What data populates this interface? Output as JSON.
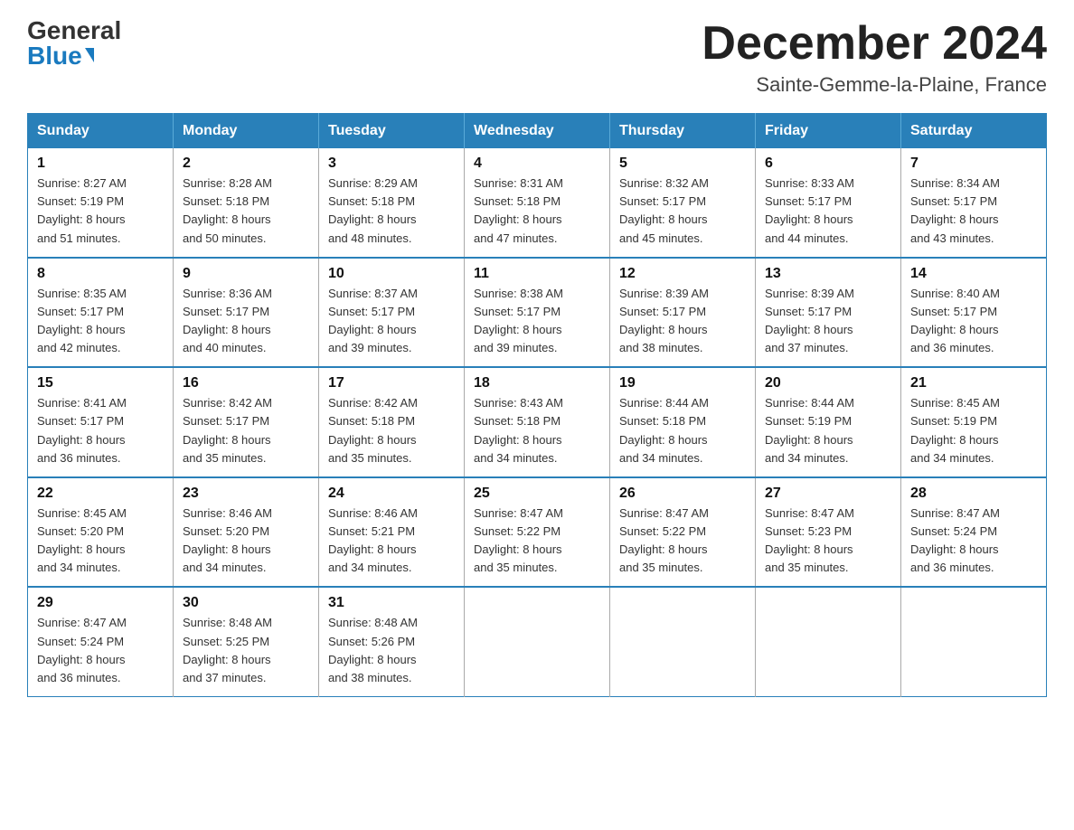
{
  "logo": {
    "general": "General",
    "blue": "Blue"
  },
  "title": "December 2024",
  "location": "Sainte-Gemme-la-Plaine, France",
  "days_of_week": [
    "Sunday",
    "Monday",
    "Tuesday",
    "Wednesday",
    "Thursday",
    "Friday",
    "Saturday"
  ],
  "weeks": [
    [
      {
        "day": "1",
        "sunrise": "8:27 AM",
        "sunset": "5:19 PM",
        "daylight": "8 hours and 51 minutes."
      },
      {
        "day": "2",
        "sunrise": "8:28 AM",
        "sunset": "5:18 PM",
        "daylight": "8 hours and 50 minutes."
      },
      {
        "day": "3",
        "sunrise": "8:29 AM",
        "sunset": "5:18 PM",
        "daylight": "8 hours and 48 minutes."
      },
      {
        "day": "4",
        "sunrise": "8:31 AM",
        "sunset": "5:18 PM",
        "daylight": "8 hours and 47 minutes."
      },
      {
        "day": "5",
        "sunrise": "8:32 AM",
        "sunset": "5:17 PM",
        "daylight": "8 hours and 45 minutes."
      },
      {
        "day": "6",
        "sunrise": "8:33 AM",
        "sunset": "5:17 PM",
        "daylight": "8 hours and 44 minutes."
      },
      {
        "day": "7",
        "sunrise": "8:34 AM",
        "sunset": "5:17 PM",
        "daylight": "8 hours and 43 minutes."
      }
    ],
    [
      {
        "day": "8",
        "sunrise": "8:35 AM",
        "sunset": "5:17 PM",
        "daylight": "8 hours and 42 minutes."
      },
      {
        "day": "9",
        "sunrise": "8:36 AM",
        "sunset": "5:17 PM",
        "daylight": "8 hours and 40 minutes."
      },
      {
        "day": "10",
        "sunrise": "8:37 AM",
        "sunset": "5:17 PM",
        "daylight": "8 hours and 39 minutes."
      },
      {
        "day": "11",
        "sunrise": "8:38 AM",
        "sunset": "5:17 PM",
        "daylight": "8 hours and 39 minutes."
      },
      {
        "day": "12",
        "sunrise": "8:39 AM",
        "sunset": "5:17 PM",
        "daylight": "8 hours and 38 minutes."
      },
      {
        "day": "13",
        "sunrise": "8:39 AM",
        "sunset": "5:17 PM",
        "daylight": "8 hours and 37 minutes."
      },
      {
        "day": "14",
        "sunrise": "8:40 AM",
        "sunset": "5:17 PM",
        "daylight": "8 hours and 36 minutes."
      }
    ],
    [
      {
        "day": "15",
        "sunrise": "8:41 AM",
        "sunset": "5:17 PM",
        "daylight": "8 hours and 36 minutes."
      },
      {
        "day": "16",
        "sunrise": "8:42 AM",
        "sunset": "5:17 PM",
        "daylight": "8 hours and 35 minutes."
      },
      {
        "day": "17",
        "sunrise": "8:42 AM",
        "sunset": "5:18 PM",
        "daylight": "8 hours and 35 minutes."
      },
      {
        "day": "18",
        "sunrise": "8:43 AM",
        "sunset": "5:18 PM",
        "daylight": "8 hours and 34 minutes."
      },
      {
        "day": "19",
        "sunrise": "8:44 AM",
        "sunset": "5:18 PM",
        "daylight": "8 hours and 34 minutes."
      },
      {
        "day": "20",
        "sunrise": "8:44 AM",
        "sunset": "5:19 PM",
        "daylight": "8 hours and 34 minutes."
      },
      {
        "day": "21",
        "sunrise": "8:45 AM",
        "sunset": "5:19 PM",
        "daylight": "8 hours and 34 minutes."
      }
    ],
    [
      {
        "day": "22",
        "sunrise": "8:45 AM",
        "sunset": "5:20 PM",
        "daylight": "8 hours and 34 minutes."
      },
      {
        "day": "23",
        "sunrise": "8:46 AM",
        "sunset": "5:20 PM",
        "daylight": "8 hours and 34 minutes."
      },
      {
        "day": "24",
        "sunrise": "8:46 AM",
        "sunset": "5:21 PM",
        "daylight": "8 hours and 34 minutes."
      },
      {
        "day": "25",
        "sunrise": "8:47 AM",
        "sunset": "5:22 PM",
        "daylight": "8 hours and 35 minutes."
      },
      {
        "day": "26",
        "sunrise": "8:47 AM",
        "sunset": "5:22 PM",
        "daylight": "8 hours and 35 minutes."
      },
      {
        "day": "27",
        "sunrise": "8:47 AM",
        "sunset": "5:23 PM",
        "daylight": "8 hours and 35 minutes."
      },
      {
        "day": "28",
        "sunrise": "8:47 AM",
        "sunset": "5:24 PM",
        "daylight": "8 hours and 36 minutes."
      }
    ],
    [
      {
        "day": "29",
        "sunrise": "8:47 AM",
        "sunset": "5:24 PM",
        "daylight": "8 hours and 36 minutes."
      },
      {
        "day": "30",
        "sunrise": "8:48 AM",
        "sunset": "5:25 PM",
        "daylight": "8 hours and 37 minutes."
      },
      {
        "day": "31",
        "sunrise": "8:48 AM",
        "sunset": "5:26 PM",
        "daylight": "8 hours and 38 minutes."
      },
      null,
      null,
      null,
      null
    ]
  ],
  "labels": {
    "sunrise": "Sunrise:",
    "sunset": "Sunset:",
    "daylight": "Daylight:"
  }
}
